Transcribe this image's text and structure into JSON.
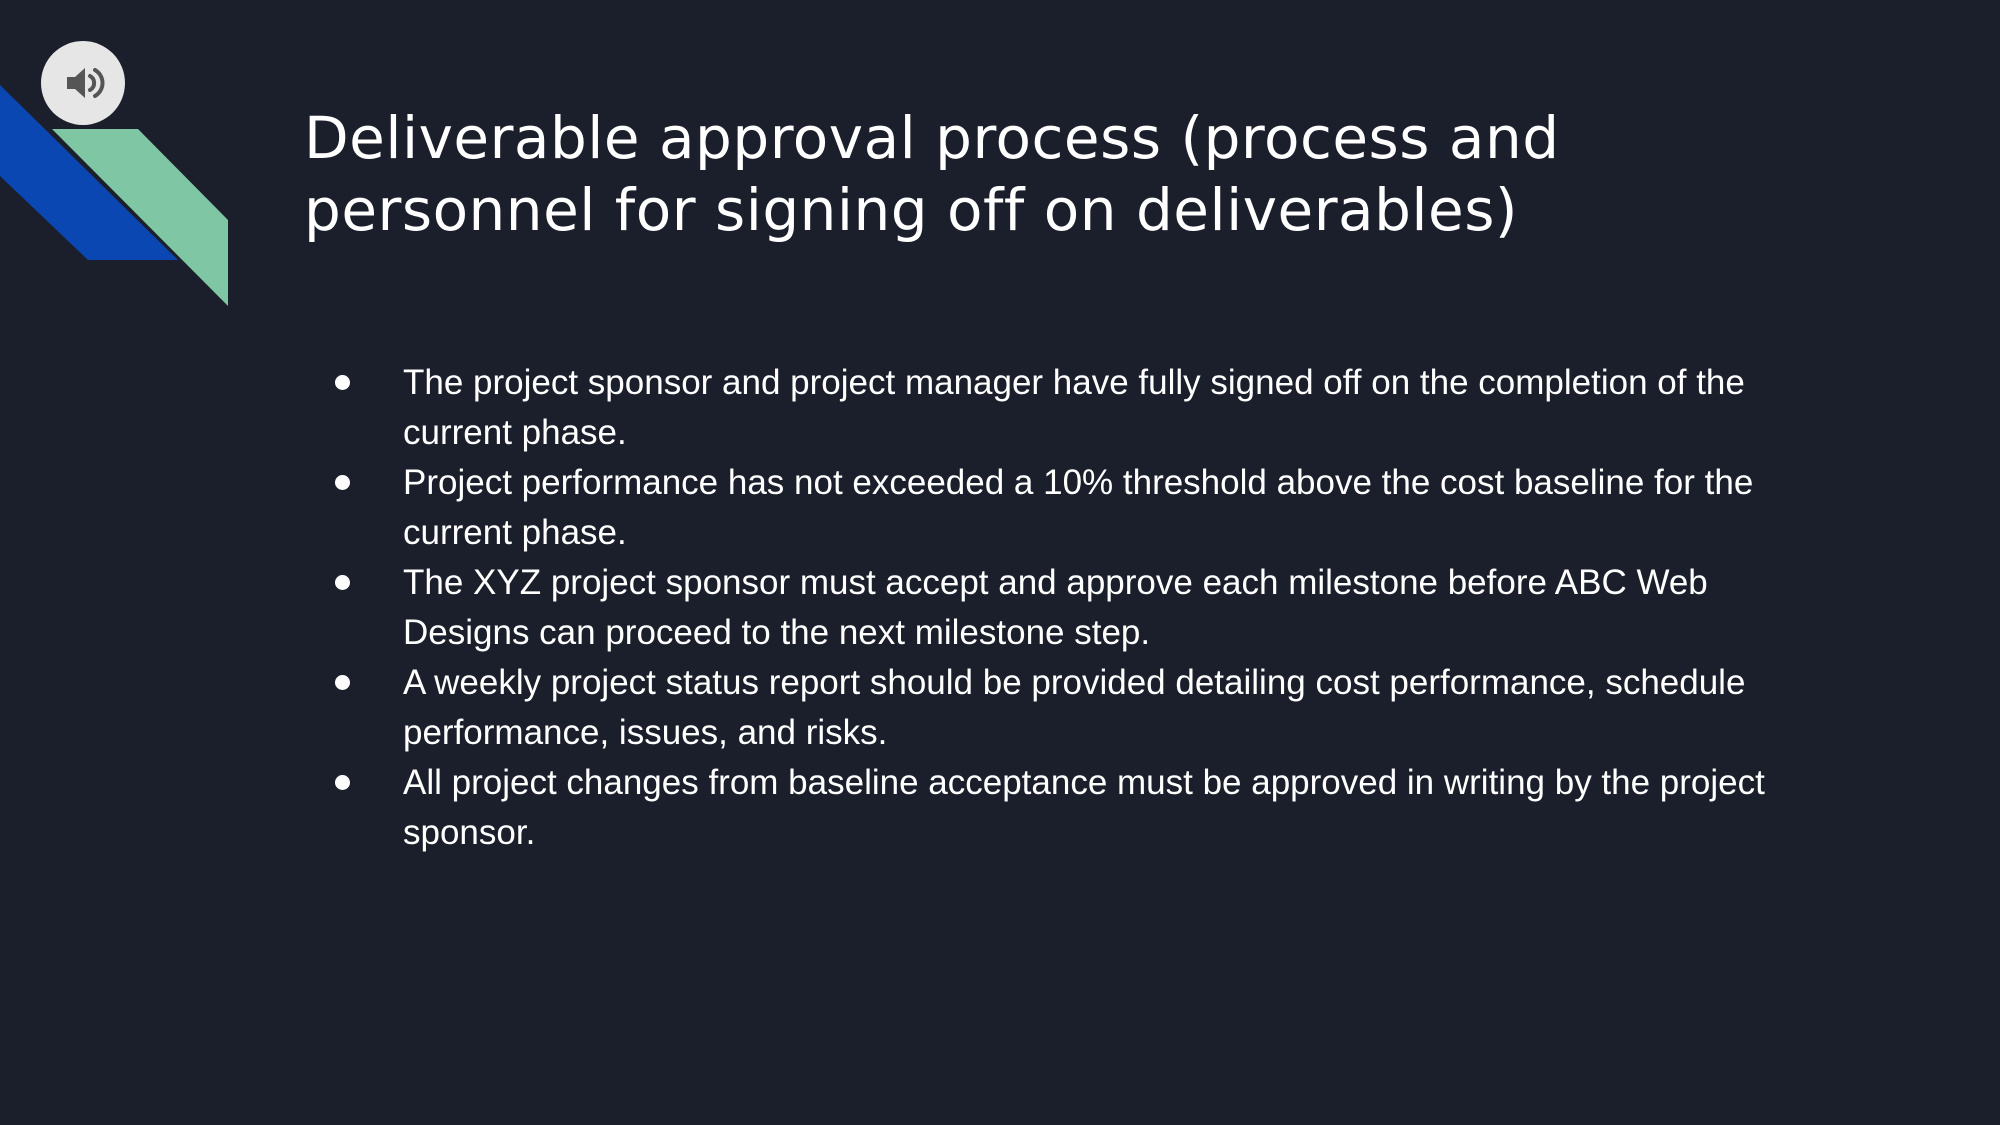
{
  "slide": {
    "title": "Deliverable approval process (process and personnel for signing off on deliverables)",
    "bullets": [
      "The project sponsor and project manager have fully signed off on the completion of the current phase.",
      "Project performance has not exceeded a 10% threshold above the cost baseline for the current phase.",
      "The XYZ project sponsor must accept and approve each milestone before ABC Web Designs can proceed to the next milestone step.",
      "A weekly project status report should be provided detailing cost performance, schedule performance, issues, and risks.",
      "All project changes from baseline acceptance must be approved in writing by the project sponsor."
    ]
  },
  "audio_control": {
    "icon": "speaker-icon"
  },
  "colors": {
    "background": "#1b1f2b",
    "stripe_blue": "#0b47b3",
    "stripe_green": "#7fc6a4",
    "text": "#ffffff",
    "audio_button_bg": "#e6e6e6",
    "audio_icon": "#555555"
  }
}
